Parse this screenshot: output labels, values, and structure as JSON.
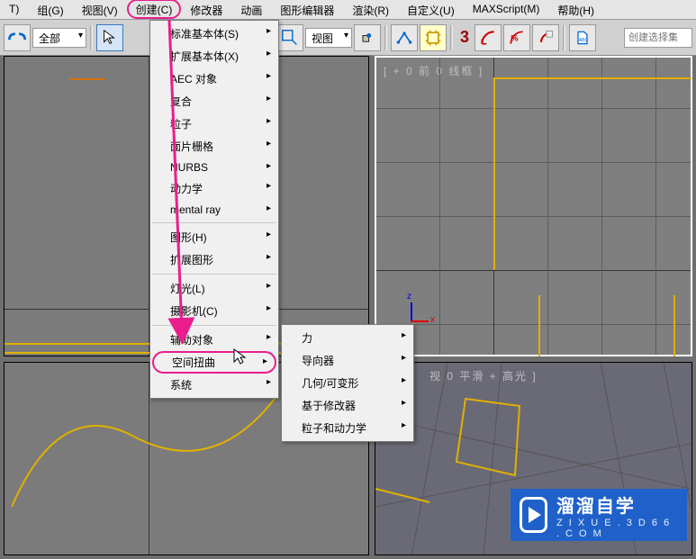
{
  "menubar": {
    "items": [
      {
        "label": "T)"
      },
      {
        "label": "组(G)"
      },
      {
        "label": "视图(V)"
      },
      {
        "label": "创建(C)"
      },
      {
        "label": "修改器"
      },
      {
        "label": "动画"
      },
      {
        "label": "图形编辑器"
      },
      {
        "label": "渲染(R)"
      },
      {
        "label": "自定义(U)"
      },
      {
        "label": "MAXScript(M)"
      },
      {
        "label": "帮助(H)"
      }
    ]
  },
  "toolbar": {
    "scope_label": "全部",
    "view_label": "视图",
    "three": "3",
    "sel_placeholder": "创建选择集"
  },
  "create_menu": {
    "items": [
      {
        "label": "标准基本体(S)",
        "sub": true
      },
      {
        "label": "扩展基本体(X)",
        "sub": true
      },
      {
        "label": "AEC 对象",
        "sub": true
      },
      {
        "label": "复合",
        "sub": true
      },
      {
        "label": "粒子",
        "sub": true
      },
      {
        "label": "面片栅格",
        "sub": true
      },
      {
        "label": "NURBS",
        "sub": true
      },
      {
        "label": "动力学",
        "sub": true
      },
      {
        "label": "mental ray",
        "sub": true
      }
    ],
    "items2": [
      {
        "label": "图形(H)",
        "sub": true
      },
      {
        "label": "扩展图形",
        "sub": true
      }
    ],
    "items3": [
      {
        "label": "灯光(L)",
        "sub": true
      },
      {
        "label": "摄影机(C)",
        "sub": true
      }
    ],
    "items4": [
      {
        "label": "辅助对象",
        "sub": true
      },
      {
        "label": "空间扭曲",
        "sub": true,
        "hl": true
      },
      {
        "label": "系统",
        "sub": true
      }
    ]
  },
  "sub_menu": {
    "items": [
      {
        "label": "力",
        "sub": true
      },
      {
        "label": "导向器",
        "sub": true
      },
      {
        "label": "几何/可变形",
        "sub": true
      },
      {
        "label": "基于修改器",
        "sub": true
      },
      {
        "label": "粒子和动力学",
        "sub": true
      }
    ]
  },
  "viewports": {
    "tr_label": "[ + 0 前 0 线框 ]",
    "br_label": "视 0 平滑 + 高光 ]"
  },
  "watermark": {
    "title": "溜溜自学",
    "url": "Z I X U E . 3 D 6 6 . C O M"
  }
}
